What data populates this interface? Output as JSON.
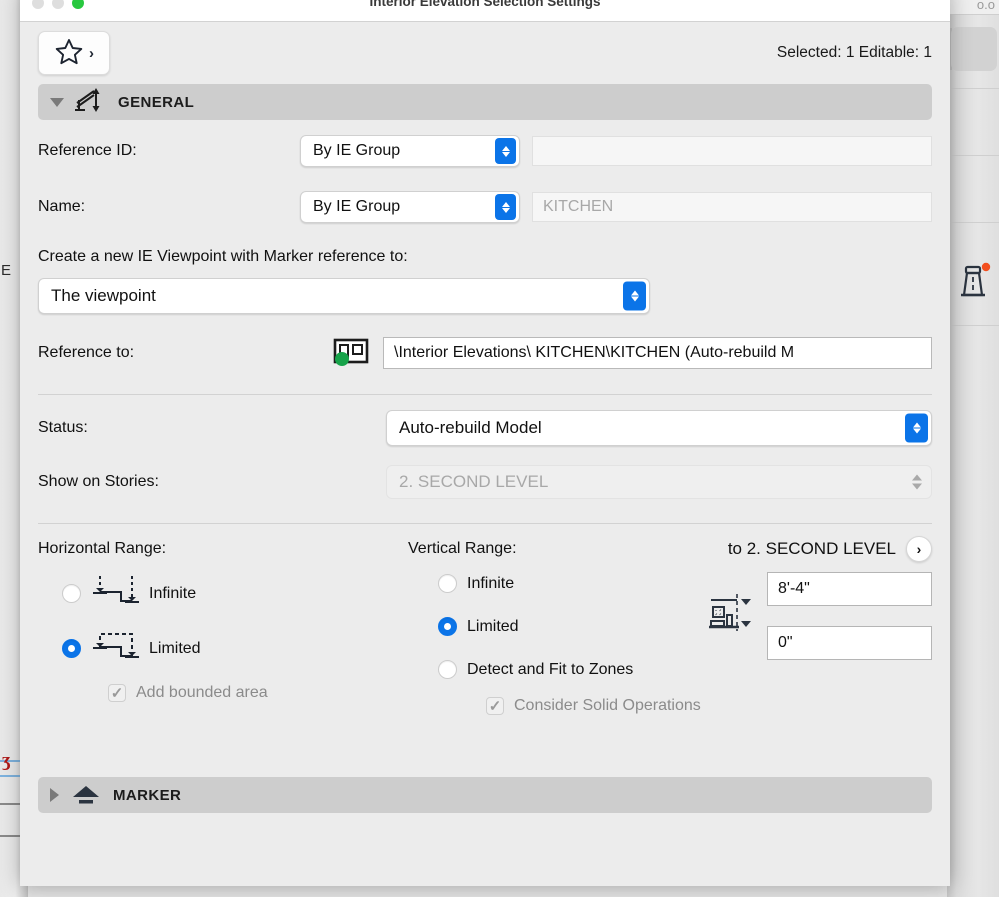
{
  "background": {
    "left_label": "E",
    "left_red_glyph": "ʒ",
    "right_top_label": "o.o",
    "lighthouse_icon": "lighthouse-icon"
  },
  "window": {
    "title": "Interior Elevation Selection Settings",
    "traffic_lights": [
      "close",
      "minimize",
      "zoom"
    ]
  },
  "toolbar": {
    "favorites_icon": "star-icon",
    "favorites_chevron": "›",
    "selection_status": "Selected: 1 Editable: 1"
  },
  "sections": {
    "general": {
      "title": "GENERAL",
      "icon": "interior-elevation-icon",
      "expanded": true,
      "disclosure": "triangle-down-icon"
    },
    "marker": {
      "title": "MARKER",
      "icon": "marker-icon",
      "expanded": false,
      "disclosure": "triangle-right-icon"
    }
  },
  "general": {
    "reference_id": {
      "label": "Reference ID:",
      "popup_value": "By IE Group",
      "field_value": "",
      "field_placeholder": ""
    },
    "name": {
      "label": "Name:",
      "popup_value": "By IE Group",
      "field_value": "",
      "field_placeholder": "KITCHEN"
    },
    "viewpoint": {
      "label": "Create a new IE Viewpoint with Marker reference to:",
      "popup_value": "The viewpoint"
    },
    "reference_to": {
      "label": "Reference to:",
      "icon": "layout-reference-icon",
      "status_dot_color": "#17a34a",
      "value": "\\Interior Elevations\\ KITCHEN\\KITCHEN (Auto-rebuild M"
    },
    "status": {
      "label": "Status:",
      "value": "Auto-rebuild Model"
    },
    "show_on_stories": {
      "label": "Show on Stories:",
      "value": "2. SECOND LEVEL",
      "disabled": true
    },
    "horizontal_range": {
      "label": "Horizontal Range:",
      "options": [
        {
          "label": "Infinite",
          "selected": false,
          "icon": "range-infinite-icon"
        },
        {
          "label": "Limited",
          "selected": true,
          "icon": "range-limited-icon"
        }
      ],
      "add_bounded_area": {
        "label": "Add bounded area",
        "checked": true,
        "disabled": true
      }
    },
    "vertical_range": {
      "label": "Vertical Range:",
      "story_link": "to 2. SECOND LEVEL",
      "story_link_icon": "chevron-right-icon",
      "options": [
        {
          "label": "Infinite",
          "selected": false
        },
        {
          "label": "Limited",
          "selected": true
        },
        {
          "label": "Detect and Fit to Zones",
          "selected": false
        }
      ],
      "consider_solid_operations": {
        "label": "Consider Solid Operations",
        "checked": true,
        "disabled": true
      },
      "height_icon": "vertical-range-icon",
      "top_value": "8'-4\"",
      "bottom_value": "0\""
    }
  },
  "colors": {
    "accent_blue": "#0b74e8",
    "panel_bg": "#ececec",
    "section_header_bg": "#cdcdcd",
    "green_dot": "#17a34a"
  }
}
